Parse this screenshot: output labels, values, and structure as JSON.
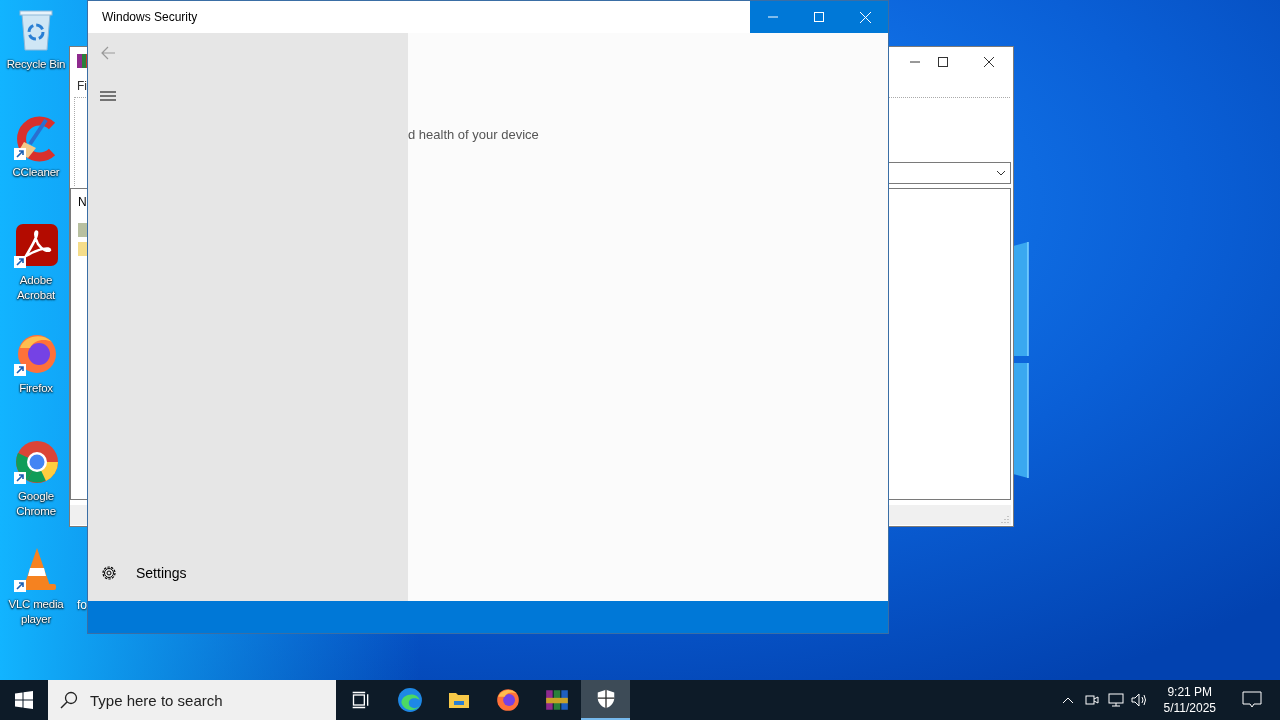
{
  "desktop": {
    "icons": [
      {
        "kind": "recycle",
        "label": "Recycle Bin",
        "shortcut": false
      },
      {
        "kind": "ccleaner",
        "label": "CCleaner",
        "shortcut": true
      },
      {
        "kind": "acrobat",
        "label": "Adobe Acrobat",
        "shortcut": true
      },
      {
        "kind": "firefox",
        "label": "Firefox",
        "shortcut": true
      },
      {
        "kind": "chrome",
        "label": "Google Chrome",
        "shortcut": true
      },
      {
        "kind": "vlc",
        "label": "VLC media player",
        "shortcut": true
      }
    ],
    "hidden_icon_label": "fo"
  },
  "background_window": {
    "menu_text": "Fi",
    "column_header": "N"
  },
  "security_window": {
    "title": "Windows Security",
    "subtitle": "d health of your device",
    "settings_label": "Settings"
  },
  "taskbar": {
    "search": {
      "placeholder": "Type here to search"
    },
    "apps": [
      {
        "kind": "taskview",
        "selected": false
      },
      {
        "kind": "edge",
        "selected": false
      },
      {
        "kind": "explorer",
        "selected": false
      },
      {
        "kind": "firefox",
        "selected": false
      },
      {
        "kind": "winrar",
        "selected": false
      },
      {
        "kind": "security",
        "selected": true
      }
    ],
    "time": "9:21 PM",
    "date": "5/11/2025"
  }
}
